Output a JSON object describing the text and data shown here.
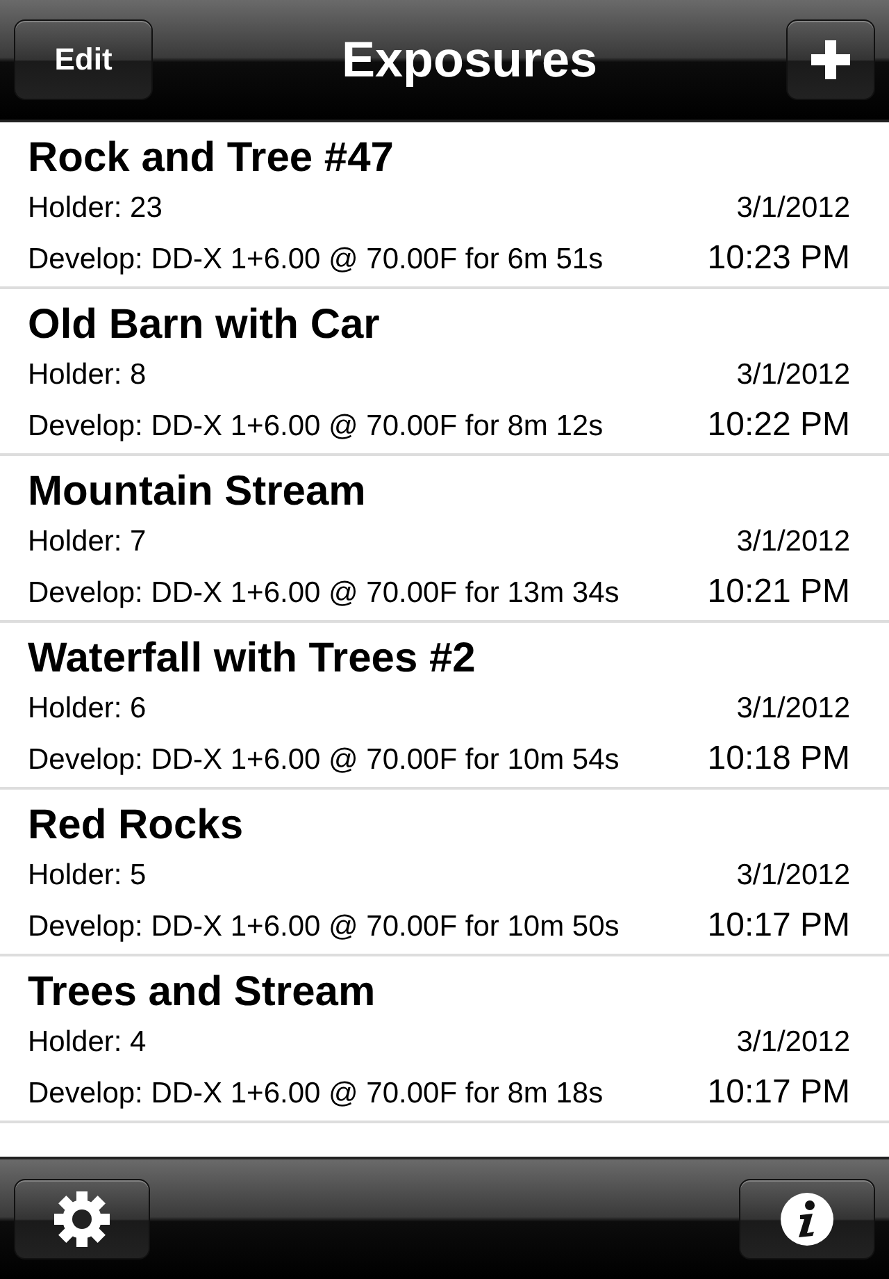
{
  "nav_bar": {
    "title": "Exposures",
    "edit_button": "Edit"
  },
  "exposures": [
    {
      "name": "Rock and Tree #47",
      "holder": "Holder: 23",
      "date": "3/1/2012",
      "develop": "Develop: DD-X 1+6.00 @ 70.00F for 6m 51s",
      "time": "10:23 PM"
    },
    {
      "name": "Old Barn with Car",
      "holder": "Holder: 8",
      "date": "3/1/2012",
      "develop": "Develop: DD-X 1+6.00 @ 70.00F for 8m 12s",
      "time": "10:22 PM"
    },
    {
      "name": "Mountain Stream",
      "holder": "Holder: 7",
      "date": "3/1/2012",
      "develop": "Develop: DD-X 1+6.00 @ 70.00F for 13m 34s",
      "time": "10:21 PM"
    },
    {
      "name": "Waterfall with Trees #2",
      "holder": "Holder: 6",
      "date": "3/1/2012",
      "develop": "Develop: DD-X 1+6.00 @ 70.00F for 10m 54s",
      "time": "10:18 PM"
    },
    {
      "name": "Red Rocks",
      "holder": "Holder: 5",
      "date": "3/1/2012",
      "develop": "Develop: DD-X 1+6.00 @ 70.00F for 10m 50s",
      "time": "10:17 PM"
    },
    {
      "name": "Trees and Stream",
      "holder": "Holder: 4",
      "date": "3/1/2012",
      "develop": "Develop: DD-X 1+6.00 @ 70.00F for 8m 18s",
      "time": "10:17 PM"
    }
  ]
}
